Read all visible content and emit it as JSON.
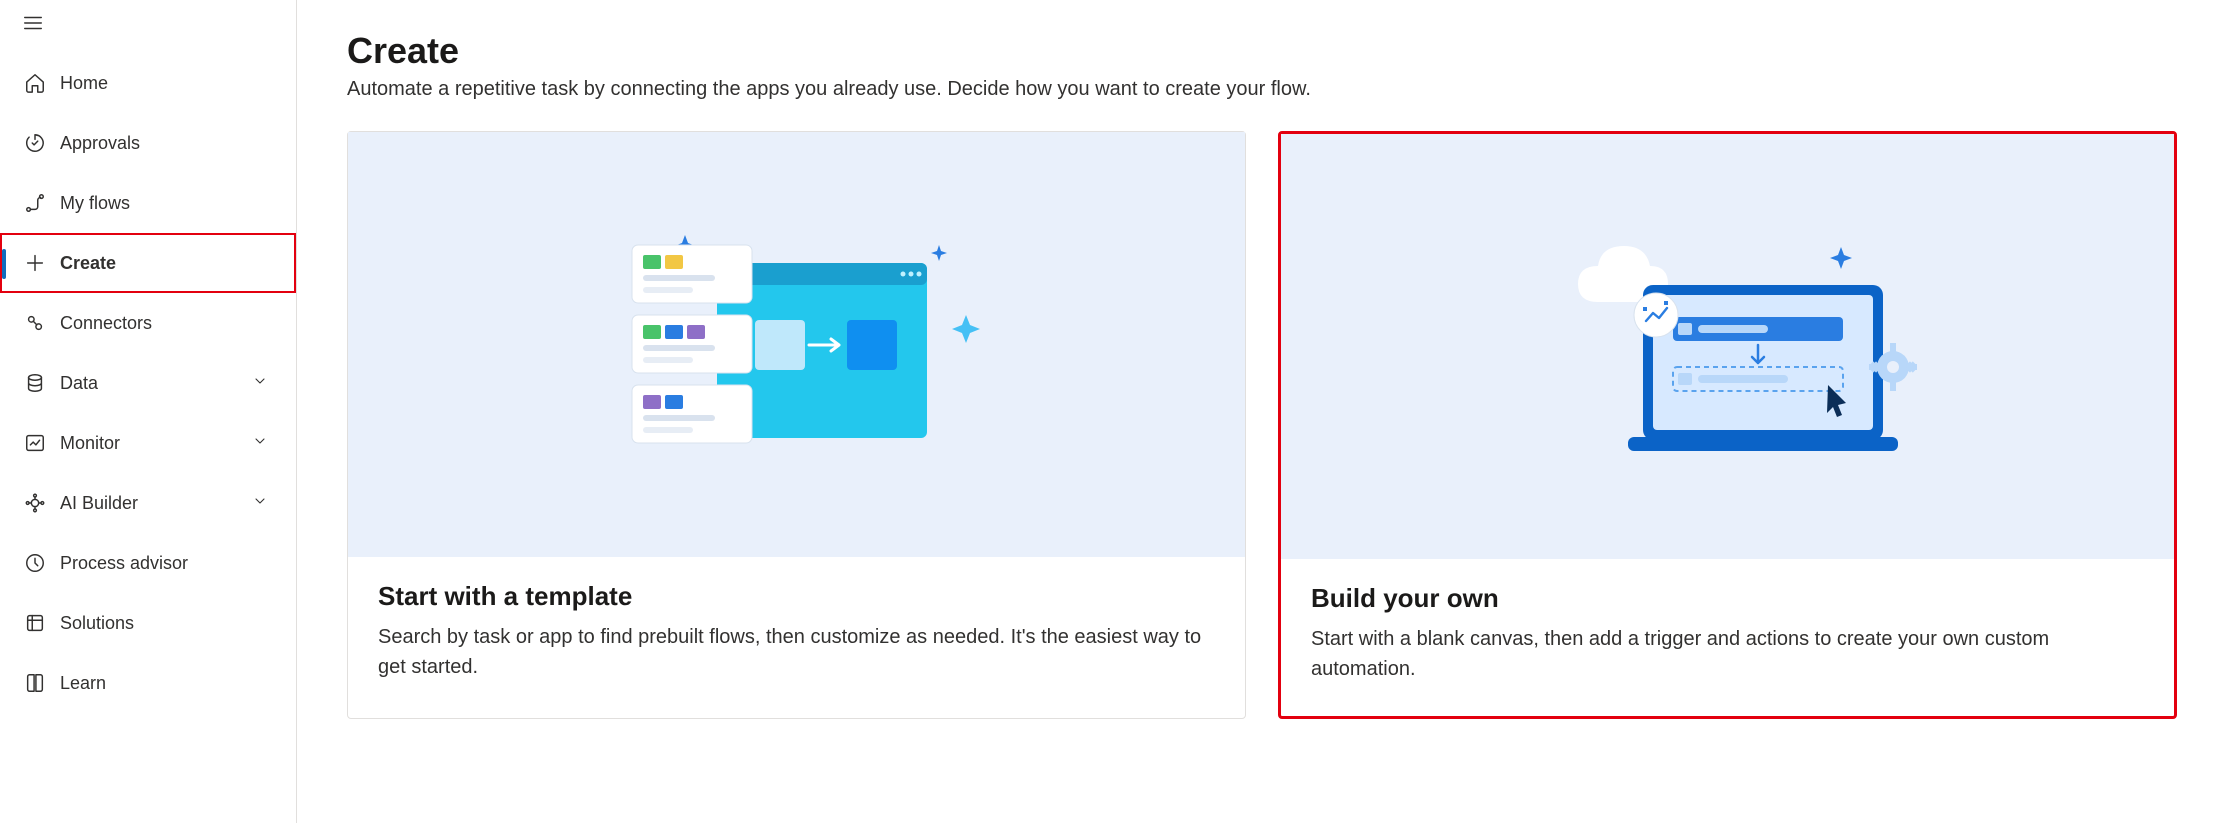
{
  "sidebar": {
    "items": [
      {
        "label": "Home",
        "icon": "home",
        "expandable": false
      },
      {
        "label": "Approvals",
        "icon": "approvals",
        "expandable": false
      },
      {
        "label": "My flows",
        "icon": "myflows",
        "expandable": false
      },
      {
        "label": "Create",
        "icon": "plus",
        "expandable": false,
        "active": true,
        "highlighted": true
      },
      {
        "label": "Connectors",
        "icon": "connectors",
        "expandable": false
      },
      {
        "label": "Data",
        "icon": "data",
        "expandable": true
      },
      {
        "label": "Monitor",
        "icon": "monitor",
        "expandable": true
      },
      {
        "label": "AI Builder",
        "icon": "aibuilder",
        "expandable": true
      },
      {
        "label": "Process advisor",
        "icon": "processadvisor",
        "expandable": false
      },
      {
        "label": "Solutions",
        "icon": "solutions",
        "expandable": false
      },
      {
        "label": "Learn",
        "icon": "learn",
        "expandable": false
      }
    ]
  },
  "header": {
    "title": "Create",
    "subtitle": "Automate a repetitive task by connecting the apps you already use. Decide how you want to create your flow."
  },
  "cards": [
    {
      "title": "Start with a template",
      "description": "Search by task or app to find prebuilt flows, then customize as needed. It's the easiest way to get started.",
      "highlighted": false
    },
    {
      "title": "Build your own",
      "description": "Start with a blank canvas, then add a trigger and actions to create your own custom automation.",
      "highlighted": true
    }
  ]
}
